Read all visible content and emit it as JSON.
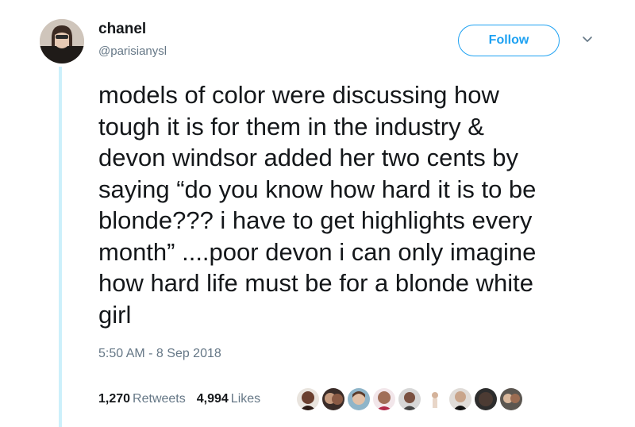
{
  "tweet": {
    "author": {
      "name": "chanel",
      "handle": "@parisianysl"
    },
    "follow_label": "Follow",
    "text": "models of color were discussing how\ntough it is for them in the industry &\ndevon windsor added her two cents by\nsaying “do you know how hard it is to be\nblonde??? i have to get highlights every\nmonth” ....poor devon i can only imagine\nhow hard life must be for a blonde white\ngirl",
    "timestamp": "5:50 AM - 8 Sep 2018",
    "stats": {
      "retweets_count": "1,270",
      "retweets_label": "Retweets",
      "likes_count": "4,994",
      "likes_label": "Likes"
    }
  },
  "colors": {
    "accent": "#1da1f2",
    "thread_line": "#ccf0fb",
    "secondary_text": "#657786",
    "primary_text": "#14171a"
  },
  "icons": {
    "menu": "chevron-down-icon"
  }
}
